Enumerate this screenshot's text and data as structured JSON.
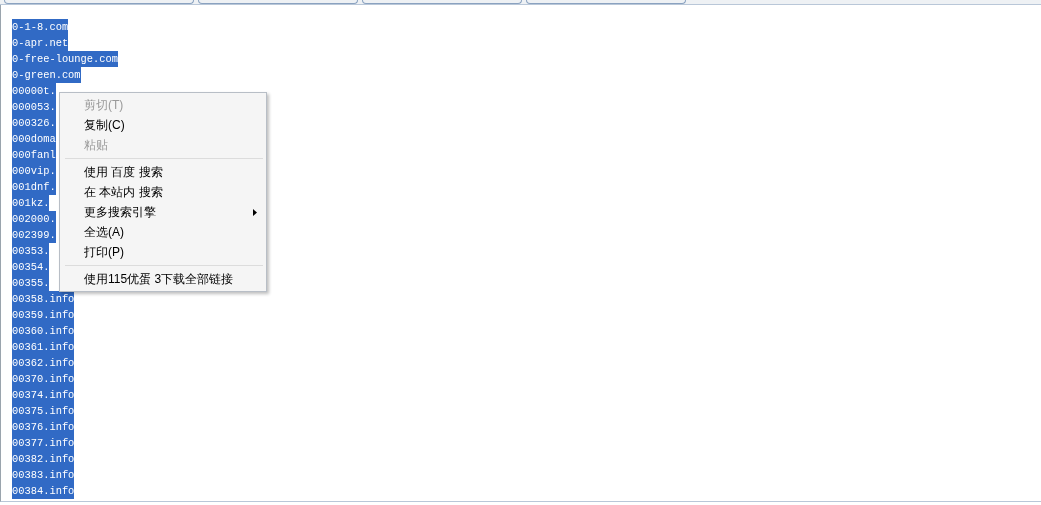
{
  "lines": [
    {
      "text": "0-1-8.com",
      "selected": true
    },
    {
      "text": "0-apr.net",
      "selected": true
    },
    {
      "text": "0-free-lounge.com",
      "selected": true
    },
    {
      "text": "0-green.com",
      "selected": true
    },
    {
      "text": "00000t.",
      "selected": true
    },
    {
      "text": "000053.",
      "selected": true
    },
    {
      "text": "000326.",
      "selected": true
    },
    {
      "text": "000doma",
      "selected": true
    },
    {
      "text": "000fanl",
      "selected": true
    },
    {
      "text": "000vip.",
      "selected": true
    },
    {
      "text": "001dnf.",
      "selected": true
    },
    {
      "text": "001kz.",
      "selected": true
    },
    {
      "text": "002000.",
      "selected": true
    },
    {
      "text": "002399.",
      "selected": true
    },
    {
      "text": "00353.",
      "selected": true
    },
    {
      "text": "00354.",
      "selected": true
    },
    {
      "text": "00355.",
      "selected": true
    },
    {
      "text": "00358.info",
      "selected": true
    },
    {
      "text": "00359.info",
      "selected": true
    },
    {
      "text": "00360.info",
      "selected": true
    },
    {
      "text": "00361.info",
      "selected": true
    },
    {
      "text": "00362.info",
      "selected": true
    },
    {
      "text": "00370.info",
      "selected": true
    },
    {
      "text": "00374.info",
      "selected": true
    },
    {
      "text": "00375.info",
      "selected": true
    },
    {
      "text": "00376.info",
      "selected": true
    },
    {
      "text": "00377.info",
      "selected": true
    },
    {
      "text": "00382.info",
      "selected": true
    },
    {
      "text": "00383.info",
      "selected": true
    },
    {
      "text": "00384.info",
      "selected": true
    }
  ],
  "context_menu": {
    "items": [
      {
        "kind": "item",
        "label": "剪切(T)",
        "disabled": true
      },
      {
        "kind": "item",
        "label": "复制(C)",
        "disabled": false
      },
      {
        "kind": "item",
        "label": "粘贴",
        "disabled": true
      },
      {
        "kind": "separator"
      },
      {
        "kind": "item",
        "label": "使用 百度 搜索",
        "disabled": false
      },
      {
        "kind": "item",
        "label": "在 本站内 搜索",
        "disabled": false
      },
      {
        "kind": "submenu",
        "label": "更多搜索引擎",
        "disabled": false
      },
      {
        "kind": "item",
        "label": "全选(A)",
        "disabled": false
      },
      {
        "kind": "item",
        "label": "打印(P)",
        "disabled": false
      },
      {
        "kind": "separator"
      },
      {
        "kind": "item",
        "label": "使用115优蛋 3下载全部链接",
        "disabled": false
      }
    ]
  }
}
